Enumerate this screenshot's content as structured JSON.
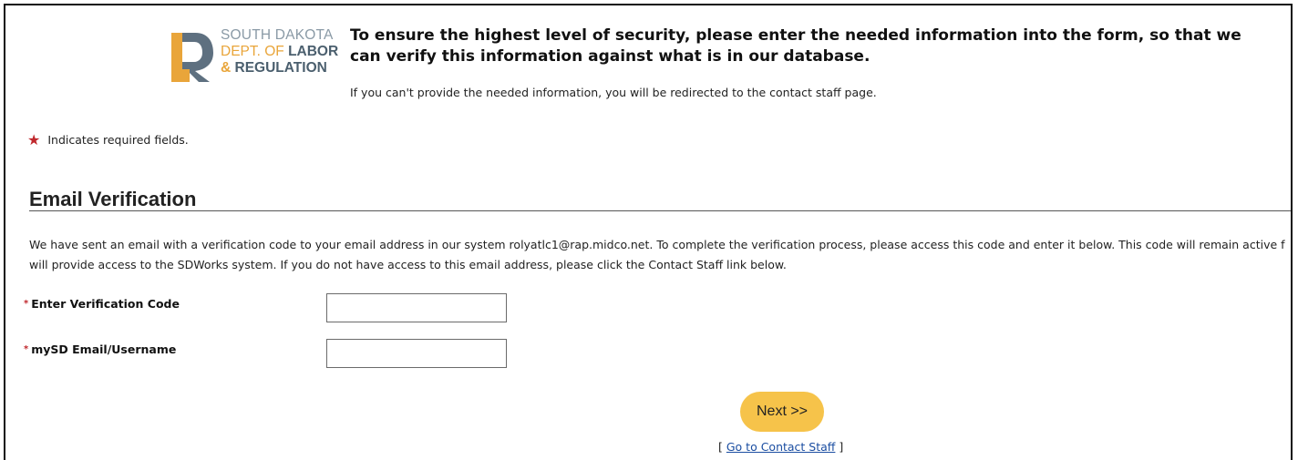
{
  "logo": {
    "line1": "SOUTH DAKOTA",
    "line2_a": "DEPT. OF ",
    "line2_b": "LABOR",
    "line3_amp": "& ",
    "line3_b": "REGULATION",
    "colors": {
      "gray": "#8a9aa6",
      "gold": "#e9a53a",
      "slate": "#4b5f6e"
    }
  },
  "header": {
    "headline": "To ensure the highest level of security, please enter the needed information into the form, so that we can verify this information against what is in our database.",
    "subline": "If you can't provide the needed information, you will be redirected to the contact staff page."
  },
  "required_note": {
    "star": "★",
    "text": "Indicates required fields."
  },
  "section": {
    "title": "Email Verification",
    "intro_line1": "We have sent an email with a verification code to your email address in our system rolyatlc1@rap.midco.net. To complete the verification process, please access this code and enter it below. This code will remain active f",
    "intro_line2": "will provide access to the SDWorks system. If you do not have access to this email address, please click the Contact Staff link below."
  },
  "form": {
    "code_label": "Enter Verification Code",
    "code_value": "",
    "username_label": "mySD Email/Username",
    "username_value": "",
    "required_marker": "*"
  },
  "actions": {
    "next_label": "Next >>",
    "contact_open": "[ ",
    "contact_link": "Go to Contact Staff",
    "contact_close": " ]"
  },
  "colors": {
    "accent_button": "#f6c34a",
    "required": "#c0282d",
    "link": "#1a4da1"
  }
}
